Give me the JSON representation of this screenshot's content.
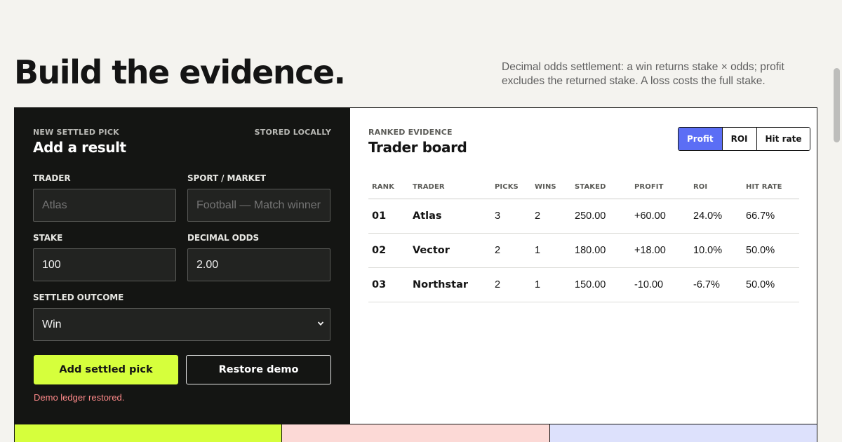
{
  "hero": {
    "title": "Build the evidence.",
    "note": "Decimal odds settlement: a win returns stake × odds; profit excludes the returned stake. A loss costs the full stake."
  },
  "form": {
    "eyebrow": "NEW SETTLED PICK",
    "storage_note": "STORED LOCALLY",
    "title": "Add a result",
    "trader": {
      "label": "TRADER",
      "placeholder": "Atlas",
      "value": ""
    },
    "market": {
      "label": "SPORT / MARKET",
      "placeholder": "Football — Match winner",
      "value": ""
    },
    "stake": {
      "label": "STAKE",
      "value": "100"
    },
    "odds": {
      "label": "DECIMAL ODDS",
      "value": "2.00"
    },
    "outcome": {
      "label": "SETTLED OUTCOME",
      "value": "Win"
    },
    "add_button": "Add settled pick",
    "restore_button": "Restore demo",
    "status": "Demo ledger restored."
  },
  "board": {
    "eyebrow": "RANKED EVIDENCE",
    "title": "Trader board",
    "sort_options": [
      "Profit",
      "ROI",
      "Hit rate"
    ],
    "active_sort": "Profit",
    "columns": [
      "RANK",
      "TRADER",
      "PICKS",
      "WINS",
      "STAKED",
      "PROFIT",
      "ROI",
      "HIT RATE"
    ],
    "rows": [
      {
        "rank": "01",
        "trader": "Atlas",
        "picks": "3",
        "wins": "2",
        "staked": "250.00",
        "profit": "+60.00",
        "roi": "24.0%",
        "hit_rate": "66.7%",
        "profit_sign": "pos"
      },
      {
        "rank": "02",
        "trader": "Vector",
        "picks": "2",
        "wins": "1",
        "staked": "180.00",
        "profit": "+18.00",
        "roi": "10.0%",
        "hit_rate": "50.0%",
        "profit_sign": "pos"
      },
      {
        "rank": "03",
        "trader": "Northstar",
        "picks": "2",
        "wins": "1",
        "staked": "150.00",
        "profit": "-10.00",
        "roi": "-6.7%",
        "hit_rate": "50.0%",
        "profit_sign": "neg"
      }
    ]
  },
  "colors": {
    "accent_lime": "#d6ff3c",
    "accent_blue": "#5b6ef5",
    "positive": "#1f7a3a",
    "negative": "#d32121",
    "tile_1": "#d6ff3c",
    "tile_2": "#fcd9d6",
    "tile_3": "#dde1fc"
  }
}
